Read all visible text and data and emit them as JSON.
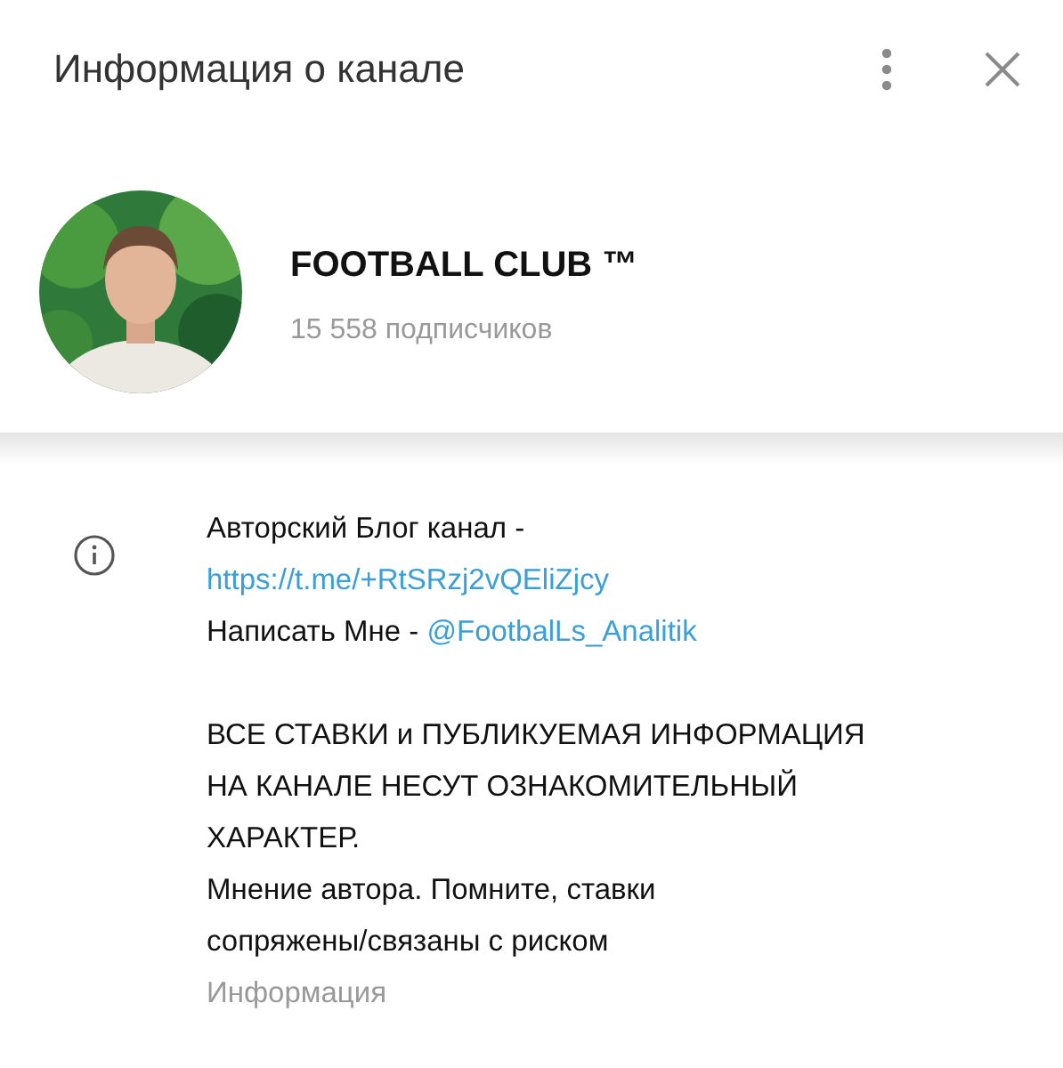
{
  "header": {
    "title": "Информация о канале"
  },
  "channel": {
    "name": "FOOTBALL CLUB ™",
    "subscribers": "15 558 подписчиков"
  },
  "info": {
    "paragraphs": [
      {
        "lines": [
          [
            {
              "kind": "text",
              "text": "Авторский Блог канал -"
            }
          ],
          [
            {
              "kind": "link",
              "text": "https://t.me/+RtSRzj2vQEliZjcy"
            }
          ],
          [
            {
              "kind": "text",
              "text": "Написать Мне - "
            },
            {
              "kind": "link",
              "text": "@FootbalLs_Analitik"
            }
          ]
        ]
      },
      {
        "lines": [
          [
            {
              "kind": "text",
              "text": "ВСЕ СТАВКИ и ПУБЛИКУЕМАЯ ИНФОРМАЦИЯ"
            }
          ],
          [
            {
              "kind": "text",
              "text": "НА КАНАЛЕ НЕСУТ ОЗНАКОМИТЕЛЬНЫЙ"
            }
          ],
          [
            {
              "kind": "text",
              "text": "ХАРАКТЕР."
            }
          ],
          [
            {
              "kind": "text",
              "text": "Мнение автора. Помните, ставки"
            }
          ],
          [
            {
              "kind": "text",
              "text": "сопряжены/связаны с риском"
            }
          ]
        ]
      }
    ],
    "caption": "Информация"
  }
}
